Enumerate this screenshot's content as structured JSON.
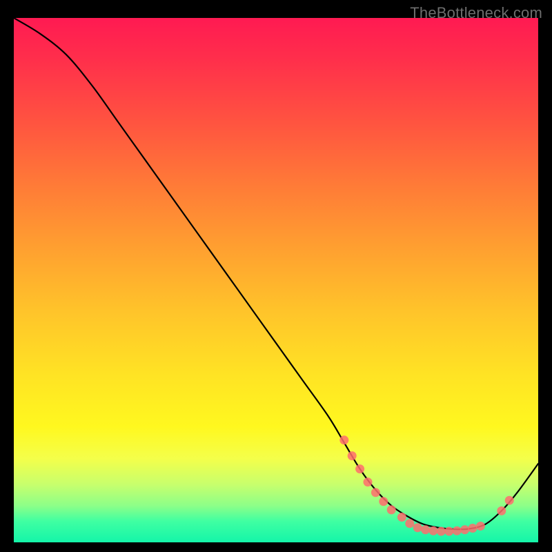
{
  "watermark": "TheBottleneck.com",
  "chart_data": {
    "type": "line",
    "title": "",
    "xlabel": "",
    "ylabel": "",
    "xlim": [
      0,
      100
    ],
    "ylim": [
      0,
      100
    ],
    "grid": false,
    "series": [
      {
        "name": "curve",
        "color": "#000000",
        "x": [
          0,
          5,
          10,
          15,
          20,
          25,
          30,
          35,
          40,
          45,
          50,
          55,
          60,
          63,
          66,
          69,
          72,
          75,
          78,
          81,
          84,
          87,
          90,
          93,
          96,
          100
        ],
        "y": [
          100,
          97,
          93,
          87,
          80,
          73,
          66,
          59,
          52,
          45,
          38,
          31,
          24,
          19,
          14,
          10,
          7,
          5,
          3.5,
          2.8,
          2.5,
          2.6,
          3.5,
          6,
          9.5,
          15
        ]
      }
    ],
    "markers": [
      {
        "x": 63.0,
        "y": 19.5
      },
      {
        "x": 64.5,
        "y": 16.5
      },
      {
        "x": 66.0,
        "y": 14.0
      },
      {
        "x": 67.5,
        "y": 11.5
      },
      {
        "x": 69.0,
        "y": 9.5
      },
      {
        "x": 70.5,
        "y": 7.8
      },
      {
        "x": 72.0,
        "y": 6.2
      },
      {
        "x": 74.0,
        "y": 4.8
      },
      {
        "x": 75.5,
        "y": 3.6
      },
      {
        "x": 77.0,
        "y": 2.8
      },
      {
        "x": 78.5,
        "y": 2.4
      },
      {
        "x": 80.0,
        "y": 2.2
      },
      {
        "x": 81.5,
        "y": 2.1
      },
      {
        "x": 83.0,
        "y": 2.1
      },
      {
        "x": 84.5,
        "y": 2.2
      },
      {
        "x": 86.0,
        "y": 2.4
      },
      {
        "x": 87.5,
        "y": 2.7
      },
      {
        "x": 89.0,
        "y": 3.1
      },
      {
        "x": 93.0,
        "y": 6.0
      },
      {
        "x": 94.5,
        "y": 8.0
      }
    ],
    "gradient_stops": [
      {
        "pos": 0.0,
        "color": "#ff1a52"
      },
      {
        "pos": 0.2,
        "color": "#ff5440"
      },
      {
        "pos": 0.44,
        "color": "#ffa030"
      },
      {
        "pos": 0.68,
        "color": "#ffe324"
      },
      {
        "pos": 0.84,
        "color": "#f4ff4a"
      },
      {
        "pos": 0.93,
        "color": "#8dff88"
      },
      {
        "pos": 1.0,
        "color": "#14f5a9"
      }
    ]
  }
}
